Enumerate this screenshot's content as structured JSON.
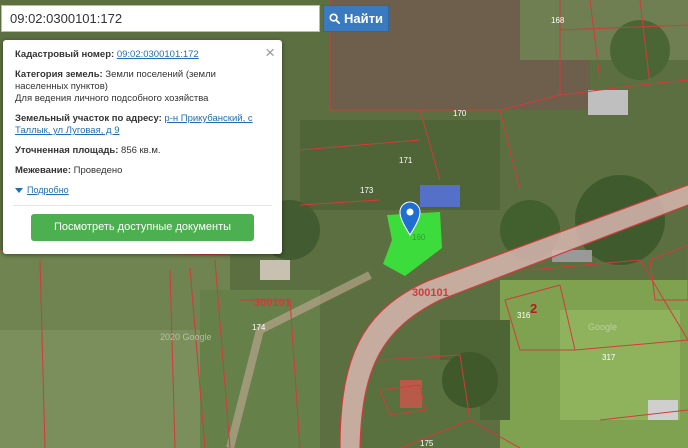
{
  "search": {
    "value": "09:02:0300101:172",
    "button_label": "Найти"
  },
  "popup": {
    "cadastral_label": "Кадастровый номер:",
    "cadastral_value": "09:02:0300101:172",
    "category_label": "Категория земель:",
    "category_value": "Земли поселений (земли населенных пунктов)",
    "usage_value": "Для ведения личного подсобного хозяйства",
    "address_label": "Земельный участок по адресу:",
    "address_value": "р-н Прикубанский, с Таллык, ул Луговая, д 9",
    "area_label": "Уточненная площадь:",
    "area_value": "856 кв.м.",
    "survey_label": "Межевание:",
    "survey_value": "Проведено",
    "more_label": "Подробно",
    "docs_button": "Посмотреть доступные документы",
    "close_symbol": "×"
  },
  "map": {
    "parcel_labels": [
      "168",
      "170",
      "171",
      "173",
      "174",
      "175",
      "316",
      "317",
      "2",
      "300101",
      "300101"
    ],
    "watermarks": [
      "2020 Google",
      "Google"
    ],
    "colors": {
      "boundary": "#d23b3b",
      "selected_parcel": "#3ddc3d",
      "marker": "#1e6fd1",
      "road": "#d9b6b0"
    }
  }
}
